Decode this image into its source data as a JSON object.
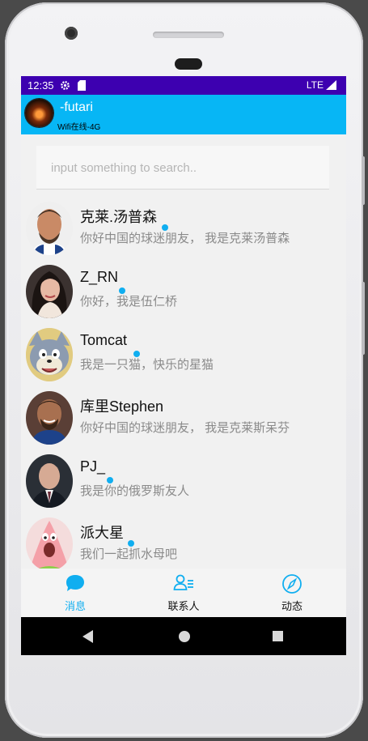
{
  "status_bar": {
    "time": "12:35",
    "network": "LTE"
  },
  "header": {
    "username": "-futari",
    "connection": "Wifi在线-4G"
  },
  "search": {
    "placeholder": "input something to search.."
  },
  "contacts": [
    {
      "name": "克莱.汤普森",
      "message": "你好中国的球迷朋友， 我是克莱汤普森",
      "avatar": "klay-avatar"
    },
    {
      "name": "Z_RN",
      "message": "你好，我是伍仁桥",
      "avatar": "girl-avatar"
    },
    {
      "name": "Tomcat",
      "message": "我是一只猫，快乐的星猫",
      "avatar": "tom-cat-avatar"
    },
    {
      "name": "库里Stephen",
      "message": "你好中国的球迷朋友， 我是克莱斯呆芬",
      "avatar": "curry-avatar"
    },
    {
      "name": "PJ_",
      "message": "我是你的俄罗斯友人",
      "avatar": "pj-avatar"
    },
    {
      "name": "派大星",
      "message": "我们一起抓水母吧",
      "avatar": "patrick-avatar"
    }
  ],
  "tabs": [
    {
      "label": "消息",
      "icon": "message-bubble-icon",
      "active": true
    },
    {
      "label": "联系人",
      "icon": "contacts-icon",
      "active": false
    },
    {
      "label": "动态",
      "icon": "compass-icon",
      "active": false
    }
  ],
  "colors": {
    "status_bar": "#3d00b0",
    "app_bar": "#07b6f5",
    "accent": "#10aef0",
    "background": "#f1f1f1"
  }
}
